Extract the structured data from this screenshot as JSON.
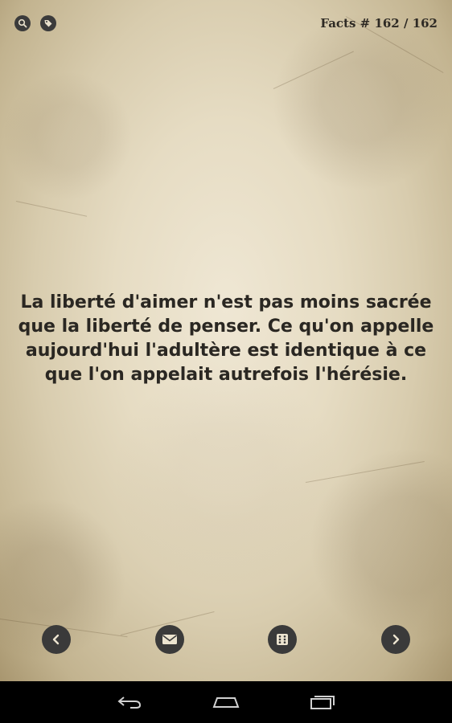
{
  "header": {
    "counter_prefix": "Facts # ",
    "current": "162",
    "separator": " / ",
    "total": "162",
    "icons": [
      "search-icon",
      "tag-icon"
    ]
  },
  "quote": {
    "text": "La liberté d'aimer n'est pas moins sacrée que la liberté de penser. Ce qu'on appelle aujourd'hui l'adultère est identique à ce que l'on appelait autrefois l'hérésie."
  },
  "toolbar": {
    "buttons": [
      "previous-icon",
      "mail-icon",
      "random-dice-icon",
      "next-icon"
    ]
  },
  "system_nav": {
    "buttons": [
      "back-icon",
      "home-icon",
      "recent-apps-icon"
    ]
  },
  "colors": {
    "paper": "#e6dcc3",
    "text": "#2a2722",
    "button": "#3a3a3a",
    "navbar": "#000000"
  }
}
